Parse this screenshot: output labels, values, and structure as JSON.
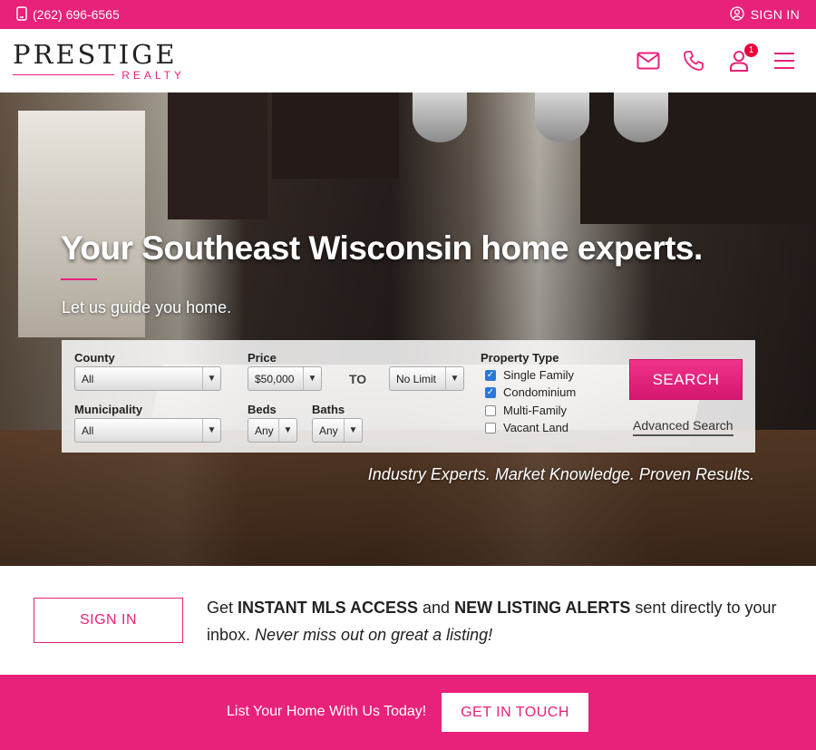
{
  "topbar": {
    "phone": "(262) 696-6565",
    "phone_icon": "mobile-phone-icon",
    "signin_label": "SIGN IN",
    "signin_icon": "user-circle-icon"
  },
  "header": {
    "brand": "PRESTIGE",
    "brand_sub": "REALTY",
    "icons": [
      "envelope-icon",
      "phone-icon",
      "user-icon",
      "hamburger-menu-icon"
    ],
    "notification_count": "1"
  },
  "hero": {
    "headline": "Your Southeast Wisconsin home experts.",
    "subheadline": "Let us guide you home.",
    "tagline": "Industry Experts. Market Knowledge. Proven Results."
  },
  "search": {
    "county_label": "County",
    "county_value": "All",
    "municipality_label": "Municipality",
    "municipality_value": "All",
    "price_label": "Price",
    "price_min": "$50,000",
    "to_label": "TO",
    "price_max": "No Limit",
    "beds_label": "Beds",
    "beds_value": "Any",
    "baths_label": "Baths",
    "baths_value": "Any",
    "property_type_label": "Property Type",
    "property_types": [
      {
        "label": "Single Family",
        "checked": true
      },
      {
        "label": "Condominium",
        "checked": true
      },
      {
        "label": "Multi-Family",
        "checked": false
      },
      {
        "label": "Vacant Land",
        "checked": false
      }
    ],
    "search_button": "SEARCH",
    "advanced_link": "Advanced Search"
  },
  "signup": {
    "button": "SIGN IN",
    "text_1": "Get ",
    "bold_1": "INSTANT MLS ACCESS",
    "text_2": " and ",
    "bold_2": "NEW LISTING ALERTS",
    "text_3": " sent directly to your inbox. ",
    "italic": "Never miss out on great a listing!"
  },
  "cta": {
    "text": "List Your Home With Us Today!",
    "button": "GET IN TOUCH"
  },
  "colors": {
    "brand_pink": "#e8217a",
    "checkbox_blue": "#2b78d8"
  }
}
